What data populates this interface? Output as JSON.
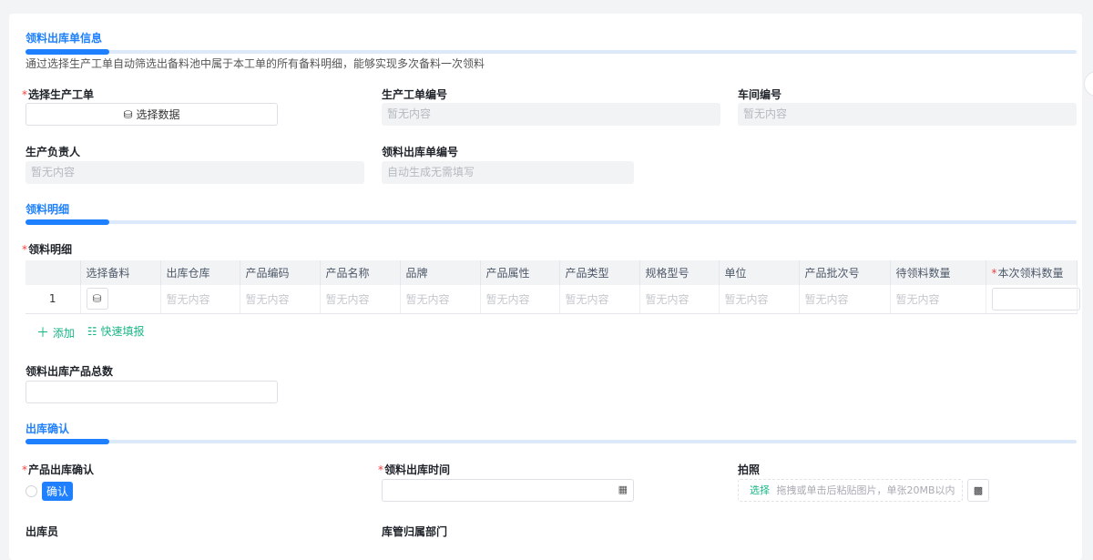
{
  "section1": {
    "title": "领料出库单信息",
    "description": "通过选择生产工单自动筛选出备料池中属于本工单的所有备料明细，能够实现多次备料一次领料"
  },
  "fields": {
    "work_order": {
      "label": "选择生产工单",
      "button": "选择数据"
    },
    "work_order_no": {
      "label": "生产工单编号",
      "value": "暂无内容"
    },
    "workshop_no": {
      "label": "车间编号",
      "value": "暂无内容"
    },
    "owner": {
      "label": "生产负责人",
      "value": "暂无内容"
    },
    "issue_no": {
      "label": "领料出库单编号",
      "value": "自动生成无需填写"
    }
  },
  "section2": {
    "title": "领料明细",
    "table_label": "领料明细"
  },
  "table": {
    "columns": [
      "",
      "选择备料",
      "出库仓库",
      "产品编码",
      "产品名称",
      "品牌",
      "产品属性",
      "产品类型",
      "规格型号",
      "单位",
      "产品批次号",
      "待领料数量",
      "本次领料数量"
    ],
    "rows": [
      {
        "index": "1",
        "cells": [
          "暂无内容",
          "暂无内容",
          "暂无内容",
          "暂无内容",
          "暂无内容",
          "暂无内容",
          "暂无内容",
          "暂无内容",
          "暂无内容",
          "暂无内容"
        ]
      }
    ]
  },
  "actions": {
    "add": "添加",
    "quick_fill": "快速填报"
  },
  "total": {
    "label": "领料出库产品总数",
    "value": ""
  },
  "section3": {
    "title": "出库确认"
  },
  "confirm": {
    "label": "产品出库确认",
    "option": "确认"
  },
  "issue_time": {
    "label": "领料出库时间",
    "value": ""
  },
  "photo": {
    "label": "拍照",
    "select": "选择",
    "hint": "拖拽或单击后粘贴图片，单张20MB以内"
  },
  "bottom": {
    "operator_label": "出库员",
    "dept_label": "库管归属部门"
  }
}
